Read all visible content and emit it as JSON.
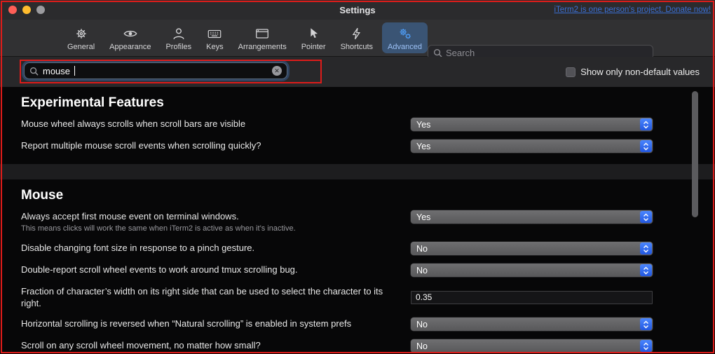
{
  "window": {
    "title": "Settings",
    "donate_link": "iTerm2 is one person’s project. Donate now!"
  },
  "toolbar": {
    "tabs": [
      {
        "label": "General",
        "icon": "gear",
        "selected": false
      },
      {
        "label": "Appearance",
        "icon": "eye",
        "selected": false
      },
      {
        "label": "Profiles",
        "icon": "person",
        "selected": false
      },
      {
        "label": "Keys",
        "icon": "keyboard",
        "selected": false
      },
      {
        "label": "Arrangements",
        "icon": "window-panes",
        "selected": false
      },
      {
        "label": "Pointer",
        "icon": "cursor-arrow",
        "selected": false
      },
      {
        "label": "Shortcuts",
        "icon": "lightning-bolt",
        "selected": false
      },
      {
        "label": "Advanced",
        "icon": "double-gear",
        "selected": true
      }
    ],
    "search_placeholder": "Search"
  },
  "filter": {
    "search_value": "mouse",
    "show_only_label": "Show only non-default values",
    "show_only_checked": false
  },
  "icons": {
    "clear": "✕"
  },
  "colors": {
    "accent_blue": "#3b82f6",
    "annotation_red": "#de1c1a",
    "popup_stepper_blue": "#2b63e8",
    "selected_tab_bg": "#3a5474"
  },
  "sections": [
    {
      "title": "Experimental Features",
      "rows": [
        {
          "label": "Mouse wheel always scrolls when scroll bars are visible",
          "control": "select",
          "value": "Yes"
        },
        {
          "label": "Report multiple mouse scroll events when scrolling quickly?",
          "control": "select",
          "value": "Yes"
        }
      ]
    },
    {
      "title": "Mouse",
      "rows": [
        {
          "label": "Always accept first mouse event on terminal windows.",
          "sublabel": "This means clicks will work the same when iTerm2 is active as when it’s inactive.",
          "control": "select",
          "value": "Yes"
        },
        {
          "label": "Disable changing font size in response to a pinch gesture.",
          "control": "select",
          "value": "No"
        },
        {
          "label": "Double-report scroll wheel events to work around tmux scrolling bug.",
          "control": "select",
          "value": "No"
        },
        {
          "label": "Fraction of character’s width on its right side that can be used to select the character to its right.",
          "control": "text",
          "value": "0.35"
        },
        {
          "label": "Horizontal scrolling is reversed when “Natural scrolling” is enabled in system prefs",
          "control": "select",
          "value": "No"
        },
        {
          "label": "Scroll on any scroll wheel movement, no matter how small?",
          "control": "select",
          "value": "No"
        }
      ]
    }
  ]
}
